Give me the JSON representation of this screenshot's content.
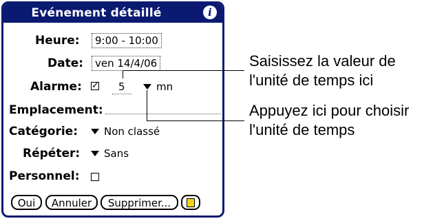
{
  "dialog": {
    "title": "Evénement détaillé",
    "info_icon": "i",
    "fields": {
      "heure_label": "Heure:",
      "heure_value": "9:00 - 10:00",
      "date_label": "Date:",
      "date_value": "ven 14/4/06",
      "alarme_label": "Alarme:",
      "alarme_checked": "✓",
      "alarme_value": "5",
      "alarme_unit": "mn",
      "emplacement_label": "Emplacement:",
      "categorie_label": "Catégorie:",
      "categorie_value": "Non classé",
      "repeter_label": "Répéter:",
      "repeter_value": "Sans",
      "personnel_label": "Personnel:"
    },
    "buttons": {
      "oui": "Oui",
      "annuler": "Annuler",
      "supprimer": "Supprimer..."
    }
  },
  "callouts": {
    "first_line1": "Saisissez la valeur de",
    "first_line2": "l'unité de temps ici",
    "second_line1": "Appuyez ici pour choisir",
    "second_line2": "l'unité de temps"
  },
  "colors": {
    "titlebar": "#0a1a70",
    "note_icon": "#f2d31a"
  }
}
